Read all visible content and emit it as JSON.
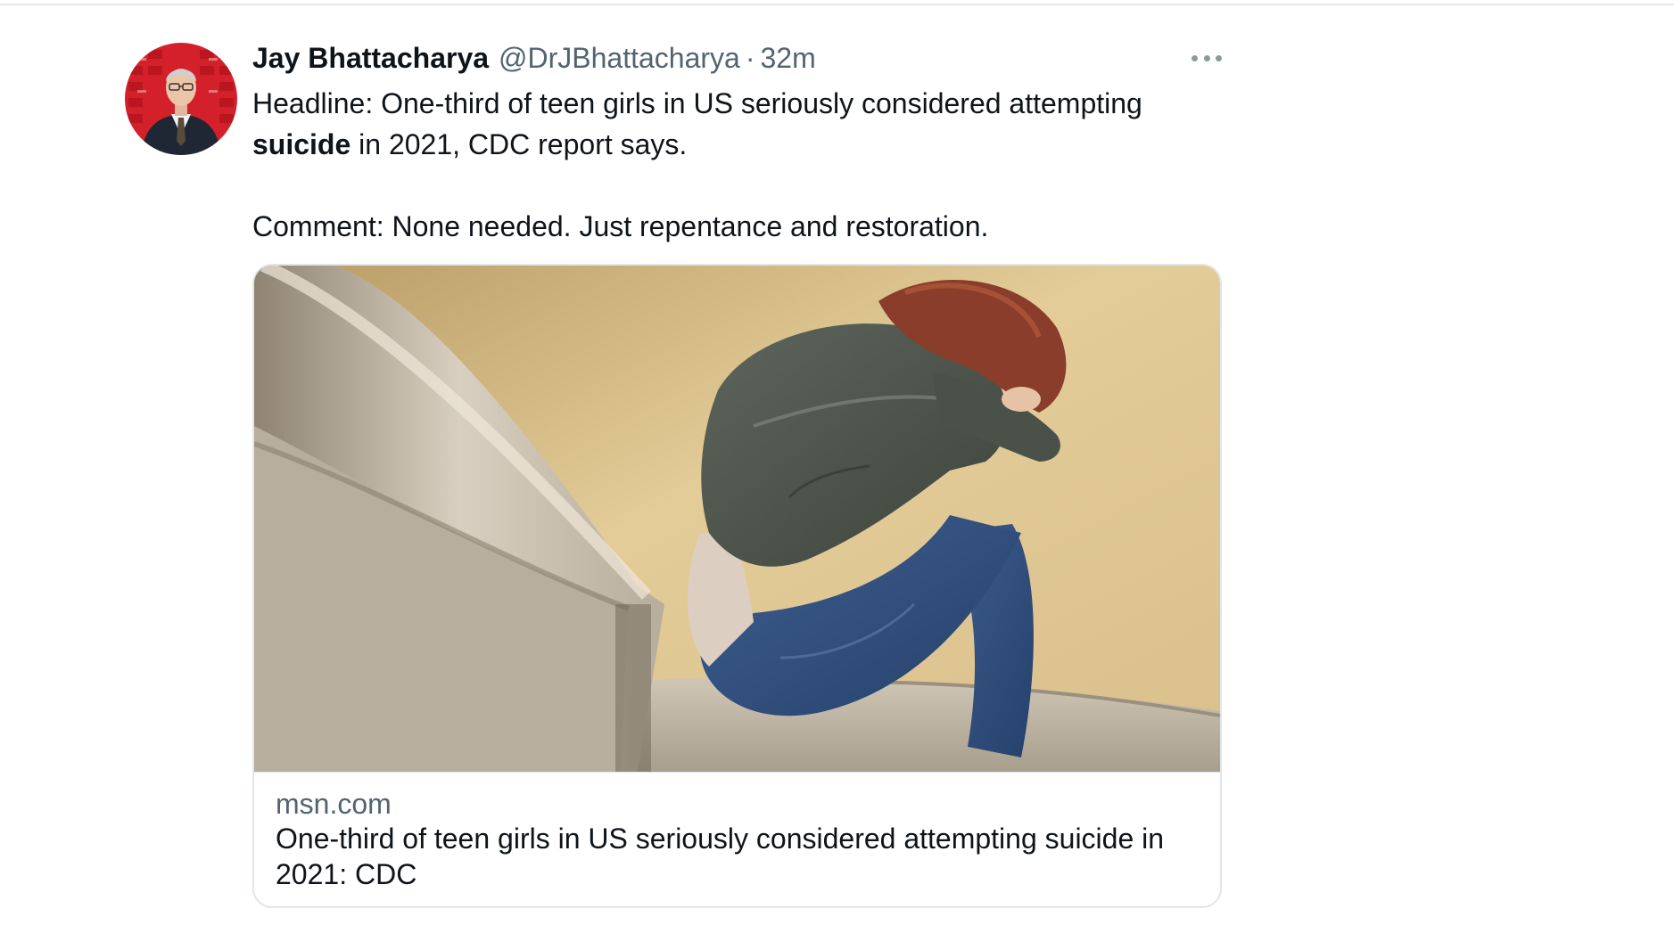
{
  "tweet": {
    "author": {
      "display_name": "Jay Bhattacharya",
      "handle": "@DrJBhattacharya",
      "avatar_icon": "profile-photo-man-in-suit"
    },
    "separator": "·",
    "time": "32m",
    "more_icon": "more-horizontal-icon",
    "text": {
      "line1_prefix": "Headline: One-third of teen girls in US seriously considered attempting",
      "bold_word": "suicide",
      "line1_suffix": " in 2021, CDC report says.",
      "comment": "Comment: None needed. Just repentance and restoration."
    },
    "link_card": {
      "domain": "msn.com",
      "title": "One-third of teen girls in US seriously considered attempting suicide in 2021: CDC",
      "image_subject": "girl-sitting-on-stairs-head-on-knees"
    }
  },
  "colors": {
    "text_primary": "#0f1419",
    "text_secondary": "#536471",
    "border": "#e1e6ea",
    "avatar_background": "#d4202a"
  }
}
